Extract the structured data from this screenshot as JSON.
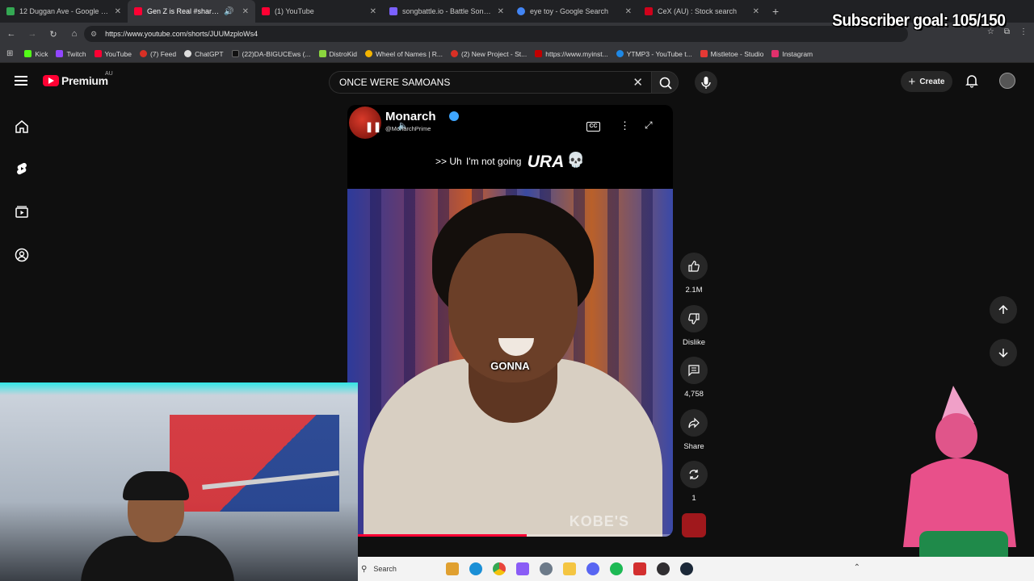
{
  "browser": {
    "tabs": [
      {
        "title": "12 Duggan Ave - Google Maps",
        "color": "#34a853",
        "active": false
      },
      {
        "title": "Gen Z is Real #sharkta",
        "color": "#ff0033",
        "active": true
      },
      {
        "title": "(1) YouTube",
        "color": "#ff0033",
        "active": false
      },
      {
        "title": "songbattle.io - Battle Songs ag",
        "color": "#7b61ff",
        "active": false
      },
      {
        "title": "eye toy - Google Search",
        "color": "#4285f4",
        "active": false
      },
      {
        "title": "CeX (AU) : Stock search",
        "color": "#d0021b",
        "active": false
      }
    ],
    "url": "https://www.youtube.com/shorts/JUUMzploWs4",
    "bookmarks": [
      {
        "label": "Kick",
        "color": "#53fc18"
      },
      {
        "label": "Twitch",
        "color": "#9146ff"
      },
      {
        "label": "YouTube",
        "color": "#ff0033"
      },
      {
        "label": "(7) Feed",
        "color": "#d93025"
      },
      {
        "label": "ChatGPT",
        "color": "#dddddd"
      },
      {
        "label": "(22)DA-BIGUCEws (...",
        "color": "#111111"
      },
      {
        "label": "DistroKid",
        "color": "#8bd63e"
      },
      {
        "label": "Wheel of Names | R...",
        "color": "#f4b400"
      },
      {
        "label": "(2) New Project - St...",
        "color": "#d93025"
      },
      {
        "label": "https://www.myinst...",
        "color": "#c00000"
      },
      {
        "label": "YTMP3 - YouTube t...",
        "color": "#1e88e5"
      },
      {
        "label": "Mistletoe - Studio",
        "color": "#e53935"
      },
      {
        "label": "Instagram",
        "color": "#e1306c"
      }
    ]
  },
  "overlay": {
    "subscriber_goal": "Subscriber goal: 105/150"
  },
  "header": {
    "logo_text": "Premium",
    "region": "AU",
    "search_value": "ONCE WERE SAMOANS",
    "create_label": "Create"
  },
  "video": {
    "channel_name": "Monarch",
    "handle": "@MonarchPrime",
    "cc_label": "CC",
    "caption_prefix": ">> Uh",
    "caption_highlight": "I'm not going",
    "caption_overlay": "URA",
    "subtitle_word": "GONNA",
    "watermark": "KOBE'S",
    "progress_fraction": 0.55
  },
  "actions": {
    "likes": "2.1M",
    "dislike_label": "Dislike",
    "comments": "4,758",
    "share_label": "Share",
    "remix_count": "1"
  },
  "taskbar": {
    "search_label": "Search",
    "icons": [
      {
        "name": "widgets",
        "color": "#e0a030"
      },
      {
        "name": "edge",
        "color": "#1a8fd6"
      },
      {
        "name": "chrome",
        "color": "#e8453c"
      },
      {
        "name": "copilot",
        "color": "#8a5cf6"
      },
      {
        "name": "settings",
        "color": "#6c7a89"
      },
      {
        "name": "explorer",
        "color": "#f4c542"
      },
      {
        "name": "discord",
        "color": "#5865f2"
      },
      {
        "name": "spotify",
        "color": "#1db954"
      },
      {
        "name": "app-red",
        "color": "#d32f2f"
      },
      {
        "name": "obs",
        "color": "#302e31"
      },
      {
        "name": "steam",
        "color": "#1b2838"
      }
    ]
  }
}
